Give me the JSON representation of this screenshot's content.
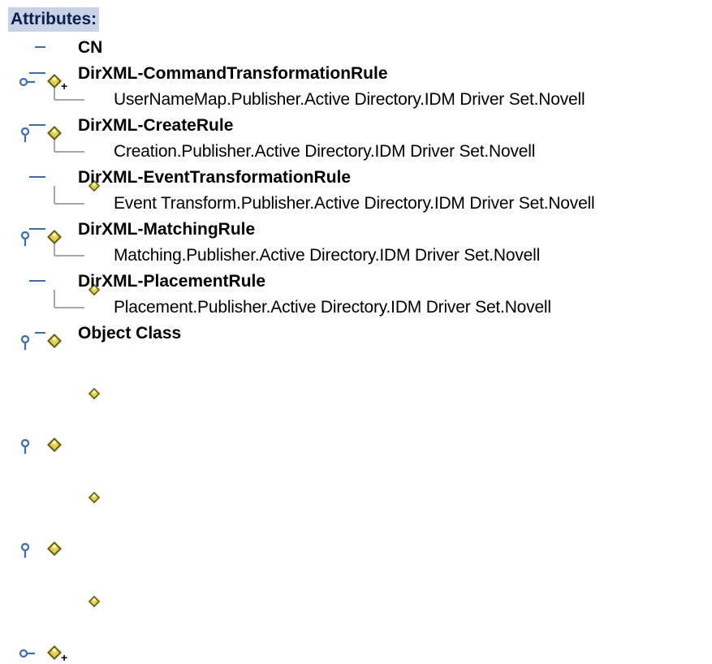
{
  "header": {
    "title": "Attributes:"
  },
  "tree": [
    {
      "kind": "attr",
      "label": "CN",
      "state": "collapsed",
      "addable": true
    },
    {
      "kind": "attr",
      "label": "DirXML-CommandTransformationRule",
      "state": "expanded",
      "addable": false
    },
    {
      "kind": "val",
      "label": "UserNameMap.Publisher.Active Directory.IDM Driver Set.Novell"
    },
    {
      "kind": "attr",
      "label": "DirXML-CreateRule",
      "state": "expanded",
      "addable": false
    },
    {
      "kind": "val",
      "label": "Creation.Publisher.Active Directory.IDM Driver Set.Novell"
    },
    {
      "kind": "attr",
      "label": "DirXML-EventTransformationRule",
      "state": "expanded",
      "addable": false
    },
    {
      "kind": "val",
      "label": "Event Transform.Publisher.Active Directory.IDM Driver Set.Novell"
    },
    {
      "kind": "attr",
      "label": "DirXML-MatchingRule",
      "state": "expanded",
      "addable": false
    },
    {
      "kind": "val",
      "label": "Matching.Publisher.Active Directory.IDM Driver Set.Novell"
    },
    {
      "kind": "attr",
      "label": "DirXML-PlacementRule",
      "state": "expanded",
      "addable": false
    },
    {
      "kind": "val",
      "label": "Placement.Publisher.Active Directory.IDM Driver Set.Novell"
    },
    {
      "kind": "attr",
      "label": "Object Class",
      "state": "collapsed",
      "addable": true
    }
  ],
  "colors": {
    "header_bg": "#c9d2e6",
    "handle": "#3b6ea5",
    "gem_fill": "#e0d25a",
    "gem_dark": "#6b5f12",
    "connector": "#8a8a8a"
  }
}
